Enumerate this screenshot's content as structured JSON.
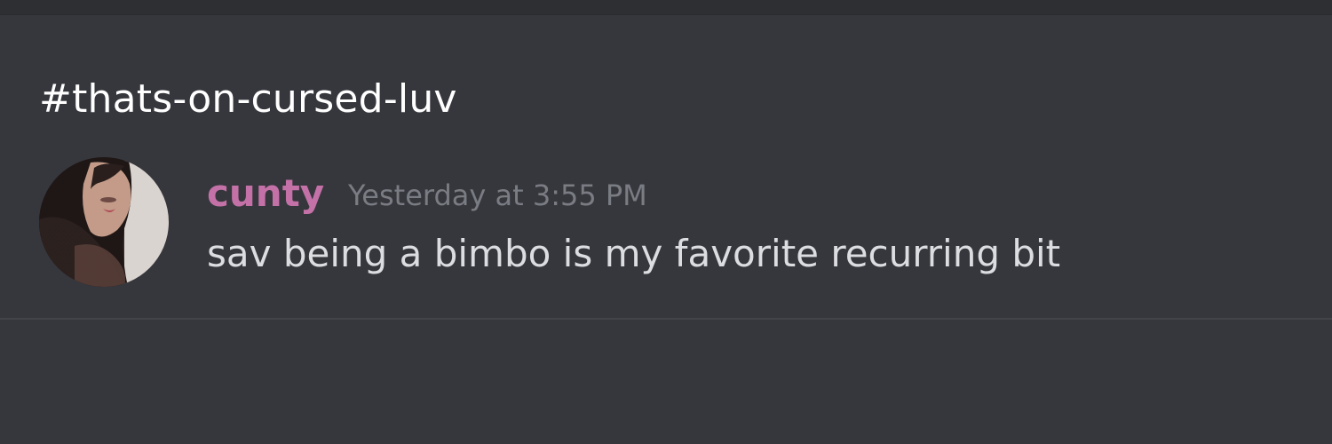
{
  "channel": {
    "name": "#thats-on-cursed-luv"
  },
  "message": {
    "author": "cunty",
    "timestamp": "Yesterday at 3:55 PM",
    "content": "sav being a bimbo is my favorite recurring bit",
    "author_color": "#c471a8"
  },
  "colors": {
    "background": "#36373d",
    "title": "#ffffff",
    "timestamp": "#7a7c83",
    "text": "#dcdde0"
  },
  "icons": {
    "avatar": "user-avatar-photo"
  }
}
